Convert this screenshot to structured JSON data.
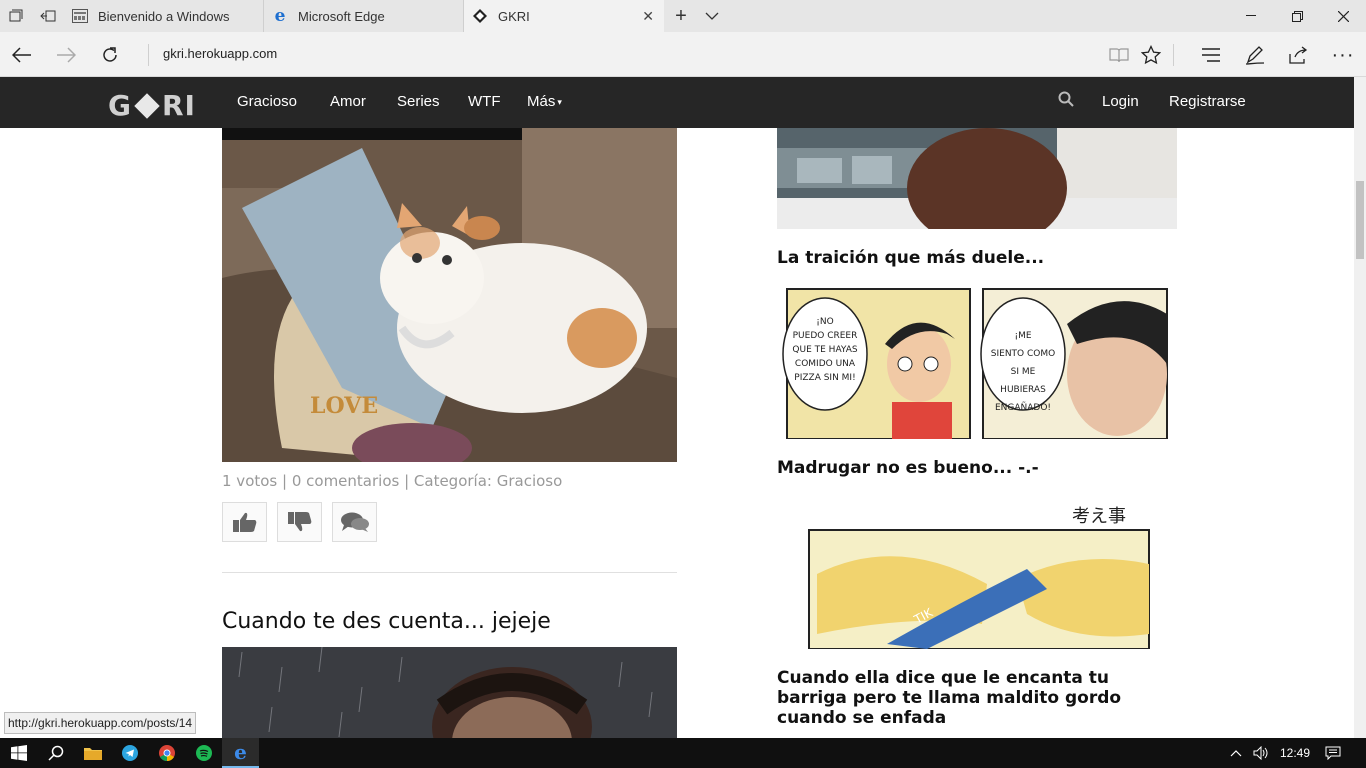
{
  "browser": {
    "tabs": [
      {
        "label": "Bienvenido a Windows",
        "icon": "window-icon"
      },
      {
        "label": "Microsoft Edge",
        "icon": "edge-icon"
      },
      {
        "label": "GKRI",
        "icon": "gkri-diamond-icon",
        "active": true
      }
    ],
    "url": "gkri.herokuapp.com",
    "status_url": "http://gkri.herokuapp.com/posts/14"
  },
  "site": {
    "logo_left": "G",
    "logo_right": "RI",
    "nav": [
      "Gracioso",
      "Amor",
      "Series",
      "WTF",
      "Más"
    ],
    "login": "Login",
    "register": "Registrarse"
  },
  "main": {
    "post_meta": "1 votos | 0 comentarios | Categoría: Gracioso",
    "next_post_title": "Cuando te des cuenta... jejeje"
  },
  "sidebar": {
    "titles": [
      "La traición que más duele...",
      "Madrugar no es bueno... -.-",
      "Cuando ella dice que le encanta tu barriga pero te llama maldito gordo cuando se enfada"
    ],
    "comic_left": "¡NO PUEDO CREER QUE TE HAYAS COMIDO UNA PIZZA SIN MI!",
    "comic_right": "¡ME SIENTO COMO SI ME HUBIERAS ENGAÑADO!",
    "pillow_text": "LOVE"
  },
  "taskbar": {
    "clock": "12:49"
  },
  "colors": {
    "site_nav_bg": "#262626",
    "taskbar_bg": "#101010",
    "meta_text": "#999999"
  }
}
